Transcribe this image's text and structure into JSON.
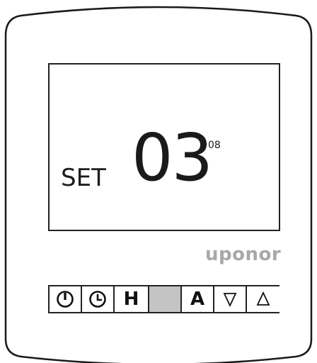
{
  "display": {
    "mode_label": "SET",
    "main_value": "03",
    "secondary_value": "08"
  },
  "brand": {
    "name": "uponor"
  },
  "buttons": [
    {
      "name": "power-button",
      "icon": "power-icon"
    },
    {
      "name": "clock-button",
      "icon": "clock-icon"
    },
    {
      "name": "h-button",
      "label": "H"
    },
    {
      "name": "blank-key",
      "label": ""
    },
    {
      "name": "a-button",
      "label": "A"
    },
    {
      "name": "down-button",
      "icon": "triangle-down-icon"
    },
    {
      "name": "up-button",
      "icon": "triangle-up-icon"
    }
  ],
  "colors": {
    "brand_gray": "#a8a8a8",
    "blank_key": "#c4c4c4",
    "outline": "#222222"
  }
}
